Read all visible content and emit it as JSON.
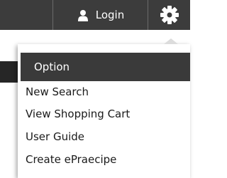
{
  "header": {
    "login_label": "Login",
    "icons": {
      "user": "user-icon",
      "settings": "gear-icon"
    }
  },
  "menu": {
    "title": "Option",
    "items": [
      "New Search",
      "View Shopping Cart",
      "User Guide",
      "Create ePraecipe"
    ]
  },
  "colors": {
    "bar": "#3c3c3c",
    "menu_header": "#3a3a3a",
    "text_light": "#ffffff",
    "text_dark": "#1a1a1a"
  }
}
